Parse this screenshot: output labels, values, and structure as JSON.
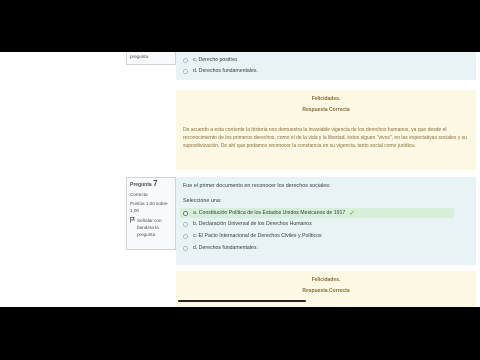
{
  "question6": {
    "info_text": "pregunta",
    "options": [
      {
        "label": "c. Derecho positivo"
      },
      {
        "label": "d. Derechos fundamentales."
      }
    ]
  },
  "feedback6": {
    "title": "Felicidades.",
    "subtitle": "Respuesta Correcta",
    "body": "De acuerdo a esta corriente la historia nos demuestra la invariable vigencia de los derechos humanos, ya que desde el reconocimiento de los primeros derechos, como el de la vida y la libertad, éstos siguen \"vivos\", en las expectativas sociales y su supositivización. De ahí que podamos reconocer la constancia en su vigencia, tanto social como jurídica."
  },
  "question7": {
    "label": "Pregunta",
    "number": "7",
    "state": "Correcta",
    "score": "Puntúa 1,00 sobre 1,00",
    "flag": "Señalar con bandera la pregunta",
    "text": "Fue el primer documento en reconocer los derechos sociales:",
    "select_label": "Seleccione una:",
    "options": [
      {
        "label": "a. Constitución Política de los Estados Unidos Mexicanos de 1917",
        "checked": true,
        "correct": true
      },
      {
        "label": "b. Declaración Universal de los Derechos Humanos",
        "checked": false
      },
      {
        "label": "c. El Pacto Internacional de Derechos Civiles y Políticos",
        "checked": false
      },
      {
        "label": "d. Derechos fundamentales.",
        "checked": false
      }
    ]
  },
  "feedback7": {
    "title": "Felicidades.",
    "subtitle": "Respuesta Correcta"
  },
  "colors": {
    "formulation_bg": "#e7f3f5",
    "outcome_bg": "#fcf8e3",
    "correct_bg": "#d5efd9",
    "check": "#5aa540"
  },
  "icons": [
    "flag-icon",
    "check-icon"
  ]
}
